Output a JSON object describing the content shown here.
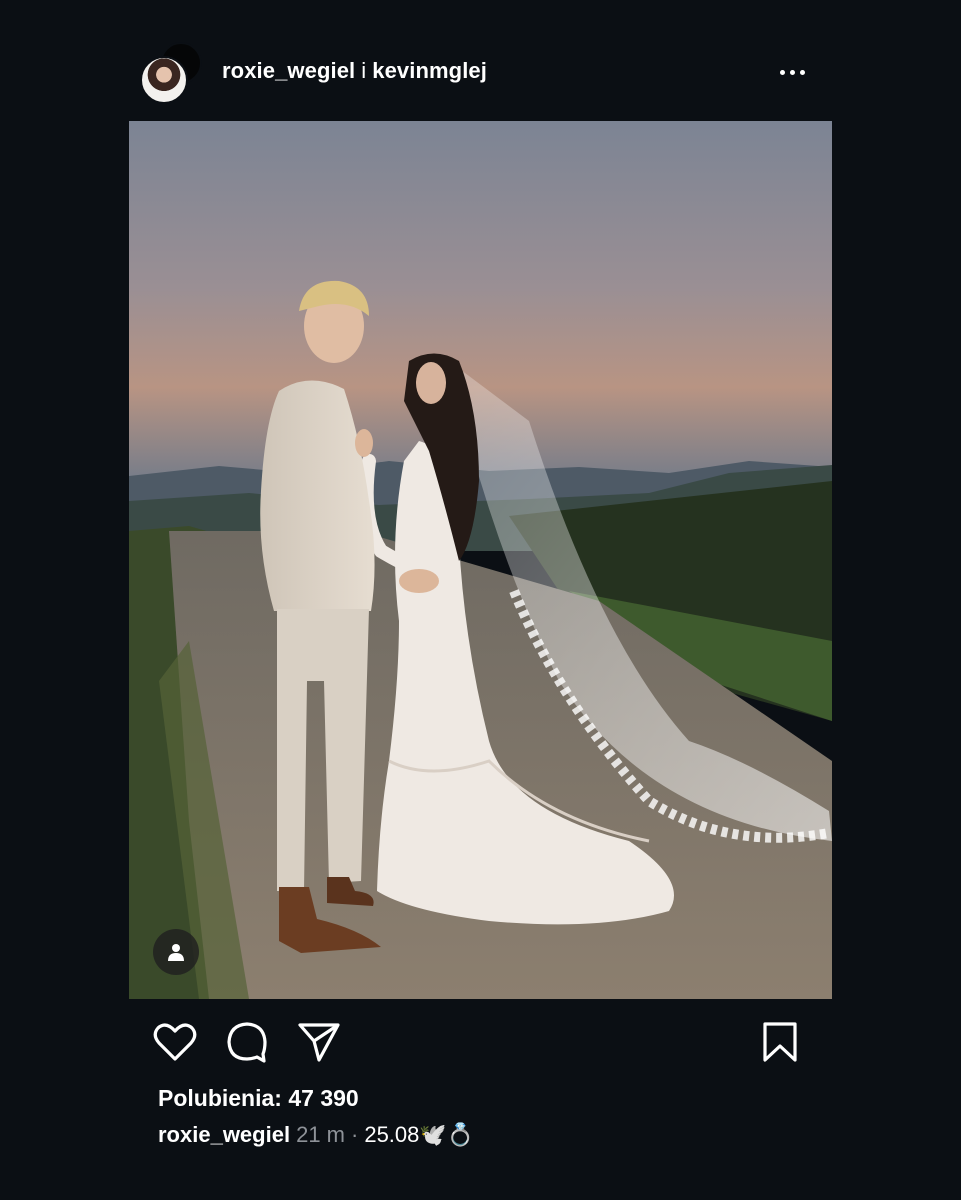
{
  "header": {
    "user_primary": "roxie_wegiel",
    "joiner": "i",
    "user_secondary": "kevinmglej",
    "avatar_icon": "profile-avatar",
    "more_icon": "more-horizontal-icon"
  },
  "post": {
    "image_alt": "Para młoda na wiejskiej drodze o zachodzie słońca",
    "tag_icon": "person-tag-icon"
  },
  "actions": {
    "like_icon": "heart-icon",
    "comment_icon": "comment-icon",
    "share_icon": "send-icon",
    "save_icon": "bookmark-icon"
  },
  "likes": {
    "text": "Polubienia: 47 390"
  },
  "caption": {
    "username": "roxie_wegiel",
    "time_ago": "21 m",
    "separator": "·",
    "text": "25.08🕊️💍"
  },
  "colors": {
    "background": "#0b0f14",
    "text_primary": "#ffffff",
    "text_secondary": "#8e9298"
  }
}
